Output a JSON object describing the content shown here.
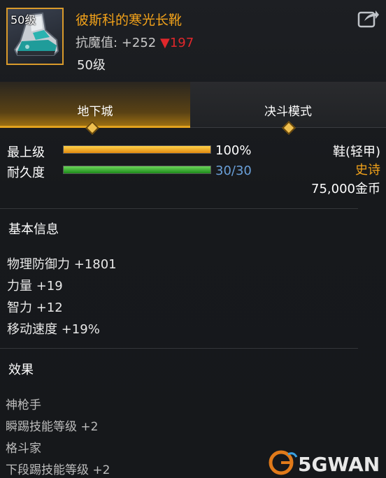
{
  "item": {
    "level_badge": "50级",
    "name": "彼斯科的寒光长靴",
    "stat_label": "抗魔值:",
    "stat_value": "+252",
    "stat_change_arrow": "▼",
    "stat_change": "197",
    "required_level": "50级",
    "icon": "boots-icon"
  },
  "header": {
    "share_icon": "share-icon"
  },
  "tabs": [
    {
      "label": "地下城",
      "active": true
    },
    {
      "label": "决斗模式",
      "active": false
    }
  ],
  "bars": {
    "level": {
      "label": "最上级",
      "value_text": "100%",
      "fraction": 1.0
    },
    "durability": {
      "label": "耐久度",
      "value_text": "30/30",
      "fraction": 1.0
    }
  },
  "info": {
    "type": "鞋(轻甲)",
    "rarity": "史诗",
    "price": "75,000金币"
  },
  "basic": {
    "title": "基本信息",
    "attributes": [
      "物理防御力 +1801",
      "力量 +19",
      "智力 +12",
      "移动速度 +19%"
    ]
  },
  "effects": {
    "title": "效果",
    "items": [
      "神枪手",
      "瞬踢技能等级 +2",
      "格斗家",
      "下段踢技能等级 +2"
    ]
  },
  "colors": {
    "name": "#f2a21a",
    "rarity": "#f2a21a",
    "decrease": "#e0272b",
    "durability_text": "#6aa0d8"
  },
  "watermark": {
    "text": "5GWAN"
  }
}
